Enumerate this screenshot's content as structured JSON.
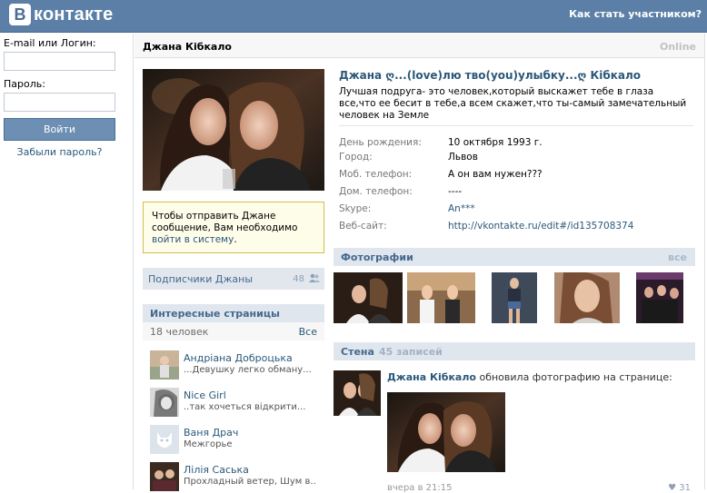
{
  "topbar": {
    "logo_letter": "В",
    "logo_text": "контакте",
    "join_link": "Как стать участником?"
  },
  "login": {
    "email_label": "E-mail или Логин:",
    "password_label": "Пароль:",
    "login_button": "Войти",
    "forgot_link": "Забыли пароль?"
  },
  "profile": {
    "name": "Джана Кібкало",
    "online": "Online",
    "full_name": "Джана ღ...(love)лю тво(you)улыбку...ღ Кібкало",
    "status": "Лучшая подруга- это человек,который выскажет тебе в глаза все,что ее бесит в тебе,а всем скажет,что ты-самый замечательный человек на Земле",
    "info": [
      {
        "key": "День рождения:",
        "value": "10 октября 1993 г.",
        "link": false
      },
      {
        "key": "Город:",
        "value": "Львов",
        "link": false
      },
      {
        "key": "Моб. телефон:",
        "value": "А он вам нужен???",
        "link": false
      },
      {
        "key": "Дом. телефон:",
        "value": "----",
        "link": false
      },
      {
        "key": "Skype:",
        "value": "An***",
        "link": true
      },
      {
        "key": "Веб-сайт:",
        "value": "http://vkontakte.ru/edit#/id135708374",
        "link": true
      }
    ]
  },
  "message_box": {
    "text": "Чтобы отправить Джане сообщение, Вам необходимо ",
    "link": "войти в систему",
    "tail": "."
  },
  "subscribers": {
    "label": "Подписчики Джаны",
    "count": "48"
  },
  "interesting": {
    "title": "Интересные страницы",
    "count_text": "18 человек",
    "all_link": "Все",
    "people": [
      {
        "name": "Андріана Доброцька",
        "status": "...Девушку легко обману..."
      },
      {
        "name": "Nice Girl",
        "status": "..так хочеться відкрити..."
      },
      {
        "name": "Ваня Драч",
        "status": "Межгорье"
      },
      {
        "name": "Лілія Саська",
        "status": "Прохладный ветер, Шум в.."
      }
    ]
  },
  "photos": {
    "title": "Фотографии",
    "all_link": "все"
  },
  "wall": {
    "title": "Стена",
    "count": "45 записей",
    "author": "Джана Кібкало",
    "action": " обновила фотографию на странице:",
    "date": "вчера в 21:15",
    "likes": "31"
  },
  "colors": {
    "topbar": "#5b7fa6",
    "link": "#2b587a",
    "block_head": "#dfe6ee",
    "accent_text": "#45688e"
  }
}
